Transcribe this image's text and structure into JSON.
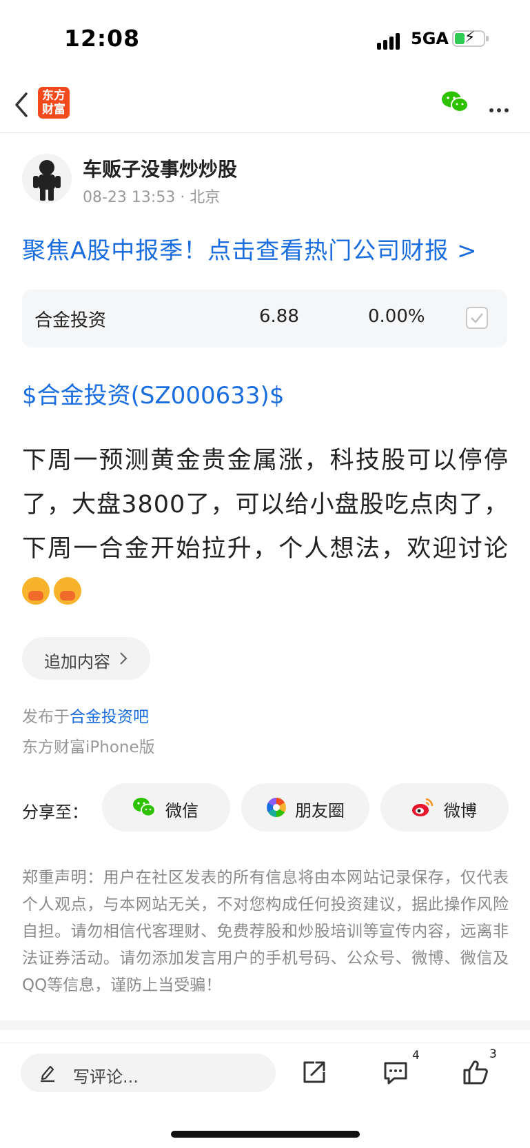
{
  "status": {
    "time": "12:08",
    "network": "5GA"
  },
  "nav": {
    "logo_line1": "东方",
    "logo_line2": "财富"
  },
  "author": {
    "name": "车贩子没事炒炒股",
    "meta": "08-23 13:53 · 北京"
  },
  "promo": {
    "text": "聚焦A股中报季！点击查看热门公司财报 >"
  },
  "stock": {
    "name": "合金投资",
    "price": "6.88",
    "change": "0.00%"
  },
  "stock_link": "$合金投资(SZ000633)$",
  "post": {
    "text_line": "下周一预测黄金贵金属涨，科技股可以停停了，大盘3800了，可以给小盘股吃点肉了，下周一合金开始拉升，个人想法，欢迎讨论"
  },
  "add_more": {
    "label": "追加内容"
  },
  "publish": {
    "prefix": "发布于",
    "bar": "合金投资吧",
    "device": "东方财富iPhone版"
  },
  "share": {
    "label": "分享至：",
    "buttons": [
      {
        "label": "微信",
        "icon": "wechat-icon"
      },
      {
        "label": "朋友圈",
        "icon": "moments-icon"
      },
      {
        "label": "微博",
        "icon": "weibo-icon"
      }
    ]
  },
  "disclaimer": "郑重声明：用户在社区发表的所有信息将由本网站记录保存，仅代表个人观点，与本网站无关，不对您构成任何投资建议，据此操作风险自担。请勿相信代客理财、免费荐股和炒股培训等宣传内容，远离非法证券活动。请勿添加发言用户的手机号码、公众号、微博、微信及QQ等信息，谨防上当受骗！",
  "bottom": {
    "comment_placeholder": "写评论...",
    "comment_count": "4",
    "like_count": "3"
  },
  "colors": {
    "link": "#1a6dde",
    "brand": "#f24a1d",
    "wechat": "#2dc100"
  }
}
